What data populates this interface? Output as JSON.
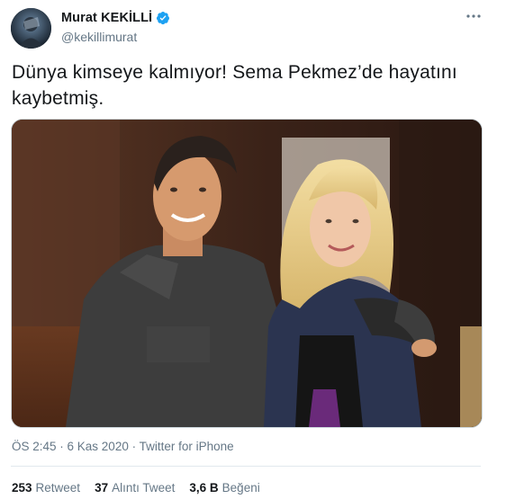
{
  "author": {
    "display_name": "Murat KEKİLLİ",
    "handle": "@kekillimurat",
    "verified_icon": "verified-badge-icon",
    "avatar_icon": "profile-avatar"
  },
  "tweet": {
    "text": "Dünya kimseye kalmıyor! Sema Pekmez’de hayatını kaybetmiş.",
    "media_description": "photo",
    "timestamp": "ÖS 2:45 · 6 Kas 2020",
    "separator": " · ",
    "source": "Twitter for iPhone"
  },
  "stats": {
    "retweets_count": "253",
    "retweets_label": "Retweet",
    "quotes_count": "37",
    "quotes_label": "Alıntı Tweet",
    "likes_count": "3,6 B",
    "likes_label": "Beğeni"
  },
  "colors": {
    "verified": "#1da1f2",
    "muted_text": "#657786",
    "primary_text": "#14171a",
    "divider": "#e1e8ed"
  },
  "icons": {
    "more": "more-options-icon"
  }
}
